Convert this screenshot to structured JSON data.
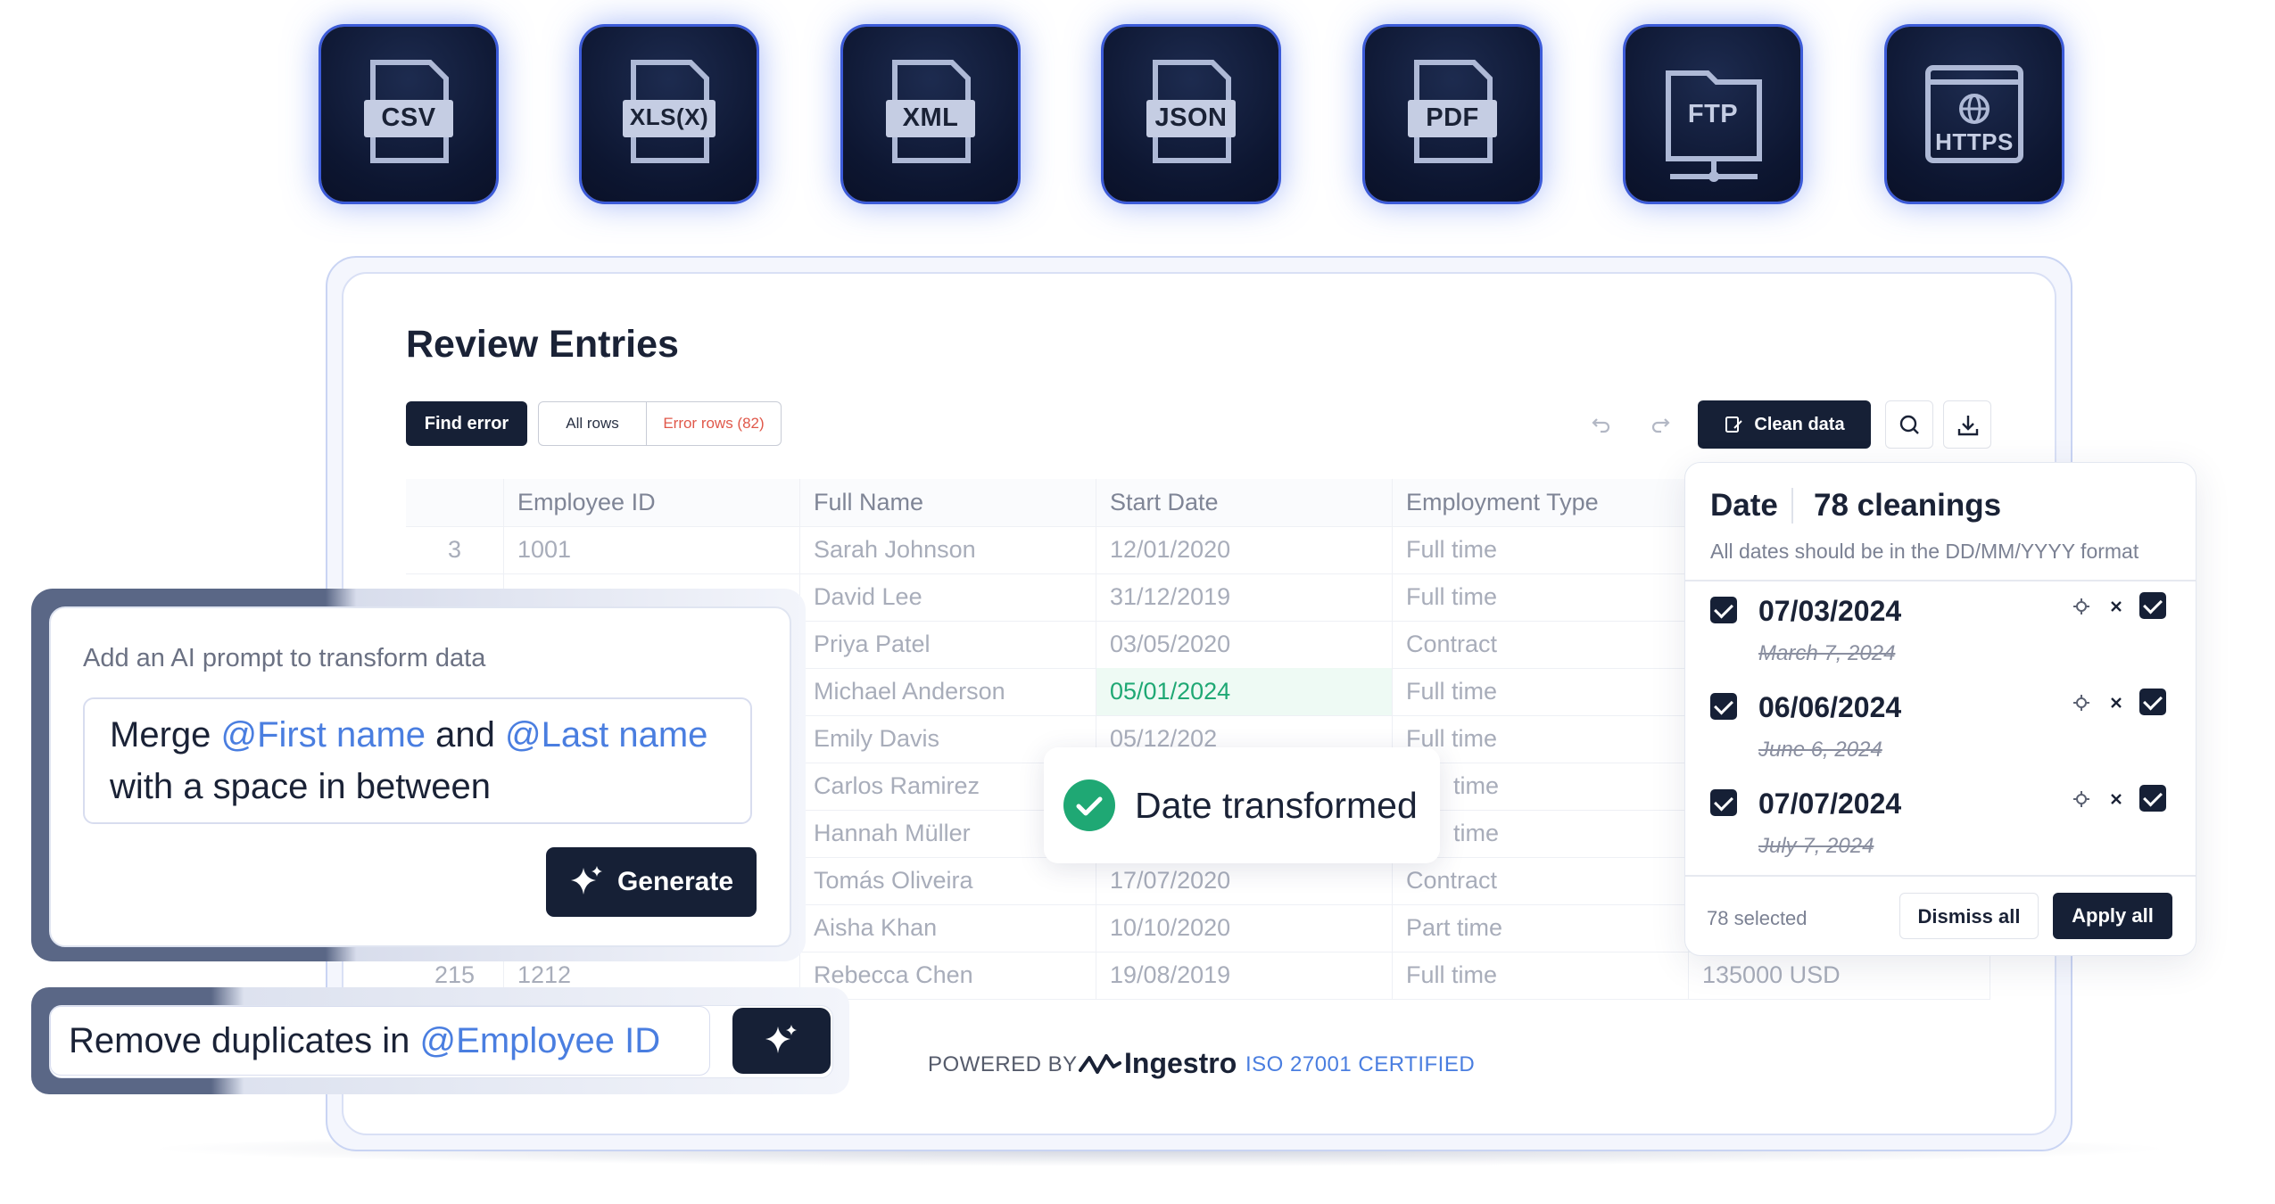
{
  "formats": [
    "CSV",
    "XLS(X)",
    "XML",
    "JSON",
    "PDF",
    "FTP",
    "HTTPS"
  ],
  "title": "Review Entries",
  "toolbar": {
    "find_error": "Find error",
    "all_rows": "All rows",
    "error_rows": "Error rows (82)",
    "clean_data": "Clean data"
  },
  "table": {
    "headers": [
      "",
      "Employee ID",
      "Full Name",
      "Start Date",
      "Employment Type",
      ""
    ],
    "rows": [
      [
        "3",
        "1001",
        "Sarah Johnson",
        "12/01/2020",
        "Full time",
        ""
      ],
      [
        "",
        "",
        "David Lee",
        "31/12/2019",
        "Full time",
        ""
      ],
      [
        "",
        "",
        "Priya Patel",
        "03/05/2020",
        "Contract",
        ""
      ],
      [
        "",
        "",
        "Michael Anderson",
        "05/01/2024",
        "Full time",
        ""
      ],
      [
        "",
        "",
        "Emily Davis",
        "05/12/202",
        "Full time",
        ""
      ],
      [
        "",
        "",
        "Carlos Ramirez",
        "",
        "time",
        ""
      ],
      [
        "",
        "",
        "Hannah Müller",
        "",
        "time",
        ""
      ],
      [
        "",
        "",
        "Tomás Oliveira",
        "17/07/2020",
        "Contract",
        ""
      ],
      [
        "",
        "",
        "Aisha Khan",
        "10/10/2020",
        "Part time",
        ""
      ],
      [
        "215",
        "1212",
        "Rebecca Chen",
        "19/08/2019",
        "Full time",
        "135000 USD"
      ]
    ],
    "highlight_color": "#1fa874"
  },
  "toast": {
    "text": "Date transformed"
  },
  "panel": {
    "field": "Date",
    "count": "78 cleanings",
    "desc": "All dates should be in the DD/MM/YYYY format",
    "items": [
      {
        "new": "07/03/2024",
        "old": "March 7, 2024"
      },
      {
        "new": "06/06/2024",
        "old": "June 6, 2024"
      },
      {
        "new": "07/07/2024",
        "old": "July 7, 2024"
      }
    ],
    "selected": "78 selected",
    "dismiss": "Dismiss all",
    "apply": "Apply all"
  },
  "prompt": {
    "label": "Add an AI prompt to transform data",
    "t1": "Merge ",
    "m1": "@First name",
    "t2": " and ",
    "m2": "@Last name",
    "t3": "with a space in between",
    "generate": "Generate"
  },
  "duplicates": {
    "text": "Remove duplicates in ",
    "mention": "@Employee ID"
  },
  "footer": {
    "powered": "POWERED BY",
    "brand": "Ingestro",
    "iso": "ISO 27001 CERTIFIED"
  },
  "accent": "#4a7ee0"
}
